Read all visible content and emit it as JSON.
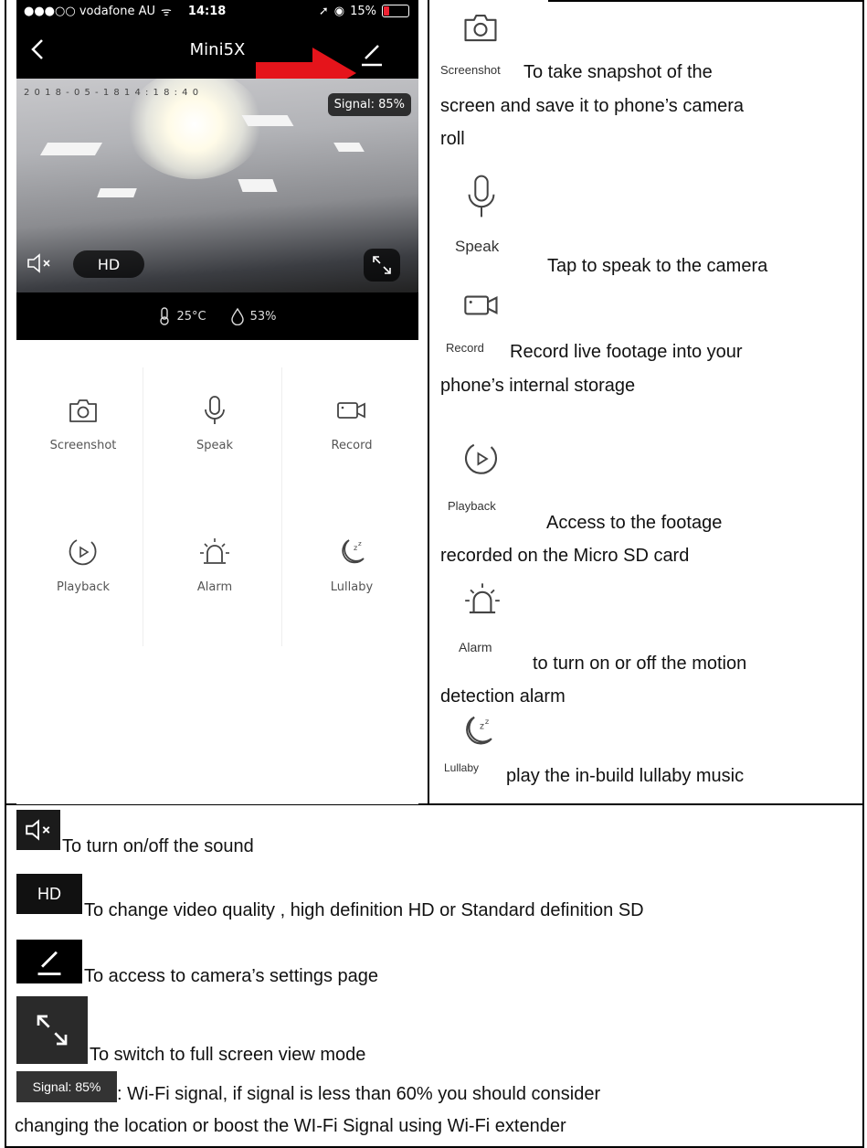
{
  "status_bar": {
    "carrier": "●●●○○ vodafone AU",
    "time": "14:18",
    "battery": "15%"
  },
  "nav": {
    "title": "Mini5X"
  },
  "video": {
    "timestamp": "2 0 1 8 - 0 5 - 1 8   1 4 : 1 8 : 4 0",
    "signal": "Signal: 85%",
    "quality": "HD"
  },
  "sensors": {
    "temperature": "25°C",
    "humidity": "53%"
  },
  "controls": [
    {
      "label": "Screenshot",
      "icon": "camera-icon"
    },
    {
      "label": "Speak",
      "icon": "microphone-icon"
    },
    {
      "label": "Record",
      "icon": "video-camera-icon"
    },
    {
      "label": "Playback",
      "icon": "playback-icon"
    },
    {
      "label": "Alarm",
      "icon": "alarm-icon"
    },
    {
      "label": "Lullaby",
      "icon": "moon-icon"
    }
  ],
  "descriptions": {
    "screenshot": {
      "label": "Screenshot",
      "text1": "To take snapshot of the",
      "text2": "screen and save it to phone’s camera",
      "text3": "roll"
    },
    "speak": {
      "label": "Speak",
      "text": "Tap to speak to the camera"
    },
    "record": {
      "label": "Record",
      "text1": "Record live footage into your",
      "text2": "phone’s internal storage"
    },
    "playback": {
      "label": "Playback",
      "text1": "Access to the footage",
      "text2": "recorded on the Micro SD card"
    },
    "alarm": {
      "label": "Alarm",
      "text1": "to turn on or off the motion",
      "text2": "detection alarm"
    },
    "lullaby": {
      "label": "Lullaby",
      "text": "play the in-build lullaby music"
    }
  },
  "bottom": {
    "sound": "To turn on/off the sound",
    "hd_chip": "HD",
    "hd": "To change video quality , high definition HD or Standard definition SD",
    "settings": "To access to camera’s settings page",
    "fullscreen": "To switch to full screen view mode",
    "signal_chip": "Signal: 85%",
    "signal1": ": Wi-Fi signal, if signal is less than 60% you should consider",
    "signal2": "changing the location or boost the WI-Fi Signal using Wi-Fi extender"
  }
}
